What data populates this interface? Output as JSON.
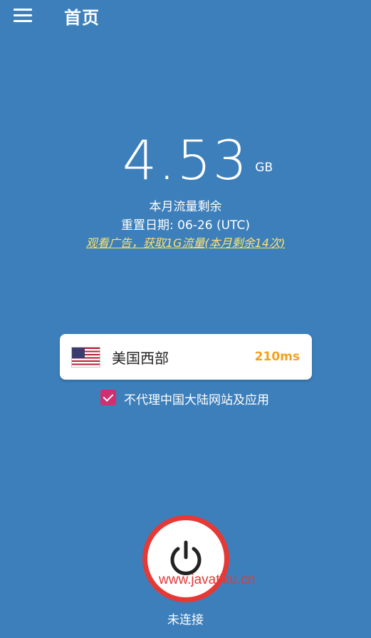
{
  "header": {
    "title": "首页"
  },
  "traffic": {
    "amount": "4.53",
    "unit": "GB",
    "remaining_label": "本月流量剩余",
    "reset_label": "重置日期: 06-26 (UTC)",
    "ad_offer": "观看广告，获取1G流量(本月剩余14次)"
  },
  "server": {
    "name": "美国西部",
    "ping": "210ms",
    "flag_icon": "us-flag-icon"
  },
  "bypass": {
    "label": "不代理中国大陆网站及应用",
    "checked": true
  },
  "connection": {
    "status": "未连接"
  },
  "watermark": "www.javatiku.cn",
  "colors": {
    "background": "#3d7fba",
    "power_ring": "#e53935",
    "checkbox": "#d0306f",
    "ping": "#f2a21a",
    "ad_link": "#ffe26b"
  }
}
